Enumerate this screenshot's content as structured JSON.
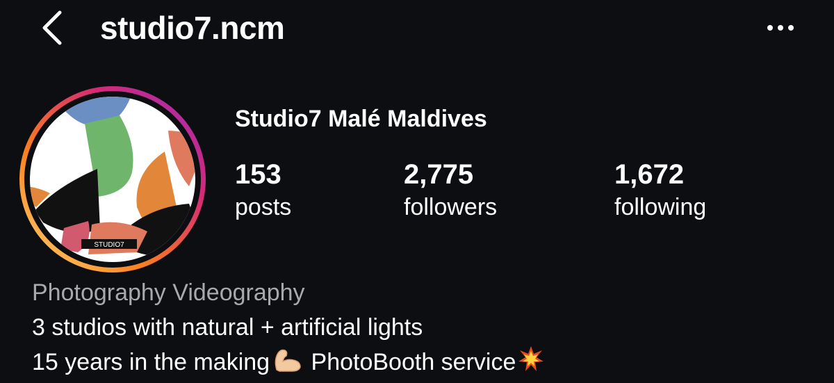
{
  "header": {
    "username": "studio7.ncm",
    "back_icon": "chevron-left-icon",
    "more_icon": "more-horizontal-icon"
  },
  "profile": {
    "display_name": "Studio7 Malé Maldives",
    "avatar_logo_text": "STUDIO7",
    "ring_colors": [
      "#feda75",
      "#fa7e1e",
      "#d62976",
      "#962fbf"
    ]
  },
  "stats": {
    "posts": {
      "count": "153",
      "label": "posts"
    },
    "followers": {
      "count": "2,775",
      "label": "followers"
    },
    "following": {
      "count": "1,672",
      "label": "following"
    }
  },
  "bio": {
    "category": "Photography Videography",
    "lines": [
      "3 studios with natural + artificial lights",
      "15 years in the making",
      "PhotoBooth service"
    ],
    "emojis": [
      "flexed-biceps-emoji",
      "collision-emoji"
    ]
  }
}
